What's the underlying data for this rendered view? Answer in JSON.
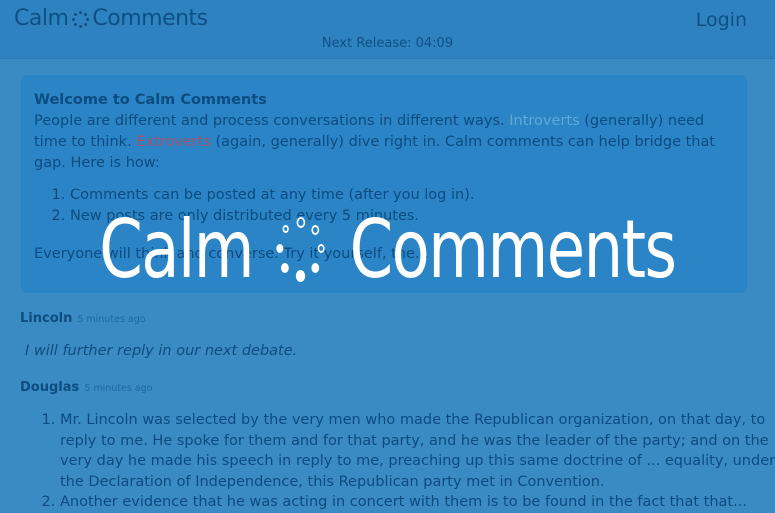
{
  "header": {
    "brand_left": "Calm",
    "brand_right": "Comments",
    "login_label": "Login",
    "release_text": "Next Release: 04:09"
  },
  "welcome": {
    "title": "Welcome to Calm Comments",
    "line1_a": "People are different and process conversations in different ways. ",
    "introverts": "Introverts",
    "line1_b": " (generally) need time to think. ",
    "extroverts": "Extroverts",
    "line1_c": " (again, generally) dive right in. Calm comments can help bridge that gap. Here is how:",
    "items": [
      "Comments can be posted at any time (after you log in).",
      "New posts are only distributed every 5 minutes."
    ],
    "everyone": "Everyone will think and converse. Try it yourself, the...",
    "footer_partial": "..."
  },
  "comments": [
    {
      "author": "Lincoln",
      "ago": "5 minutes ago",
      "text": "I will further reply in our next debate."
    },
    {
      "author": "Douglas",
      "ago": "5 minutes ago",
      "items": [
        "Mr. Lincoln was selected by the very men who made the Republican organization, on that day, to reply to me. He spoke for them and for that party, and he was the leader of the party; and on the very day he made his speech in reply to me, preaching up this same doctrine of ... equality, under the Declaration of Independence, this Republican party met in Convention.",
        "Another evidence that he was acting in concert with them is to be found in the fact that that..."
      ]
    }
  ],
  "splash": {
    "left": "Calm",
    "right": "Comments",
    "icon": "loading-spinner-icon"
  },
  "colors": {
    "background": "#3a8ac4",
    "overlay_text": "#ffffff"
  }
}
